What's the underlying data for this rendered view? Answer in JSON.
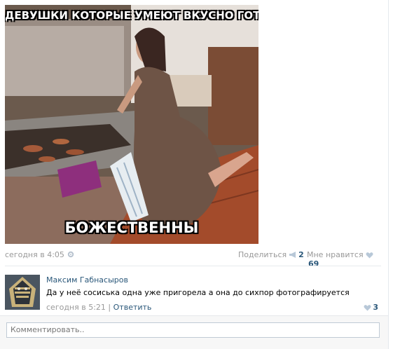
{
  "post": {
    "meme_top_text": "ДЕВУШКИ КОТОРЫЕ УМЕЮТ ВКУСНО ГОТОВИТЬ",
    "meme_bottom_text": "БОЖЕСТВЕННЫ",
    "date": "сегодня в 4:05",
    "share_label": "Поделиться",
    "share_count": "2",
    "like_label": "Мне нравится",
    "like_count": "69"
  },
  "comment": {
    "author": "Максим Габнасыров",
    "text": "Да у неё сосиська одна уже пригорела а она до сихпор фотографируется",
    "date": "сегодня в 5:21",
    "separator": "|",
    "reply_label": "Ответить",
    "like_count": "3"
  },
  "comment_form": {
    "placeholder": "Комментировать.."
  },
  "colors": {
    "link": "#2b587a",
    "muted": "#999999"
  },
  "icons": [
    "gear-icon",
    "megaphone-icon",
    "heart-icon"
  ]
}
